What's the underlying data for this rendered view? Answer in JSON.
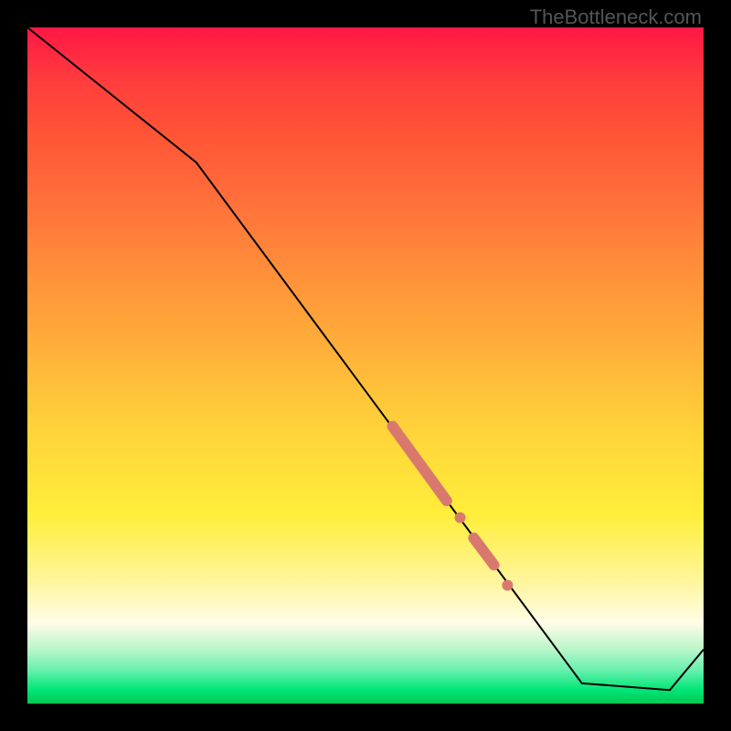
{
  "watermark": "TheBottleneck.com",
  "chart_data": {
    "type": "line",
    "title": "",
    "xlabel": "",
    "ylabel": "",
    "xlim": [
      0,
      100
    ],
    "ylim": [
      0,
      100
    ],
    "curve": {
      "x": [
        0,
        25,
        82,
        95,
        100
      ],
      "y": [
        100,
        80,
        3,
        2,
        8
      ]
    },
    "highlighted_segments": [
      {
        "x0": 54,
        "y0": 41,
        "x1": 62,
        "y1": 30
      },
      {
        "x0": 66,
        "y0": 24.5,
        "x1": 69,
        "y1": 20.5
      }
    ],
    "highlighted_points": [
      {
        "x": 64,
        "y": 27.5
      },
      {
        "x": 71,
        "y": 17.5
      }
    ],
    "colors": {
      "curve": "#000000",
      "highlight": "#d9796e",
      "gradient_top": "#ff1744",
      "gradient_bottom": "#00c853"
    }
  }
}
